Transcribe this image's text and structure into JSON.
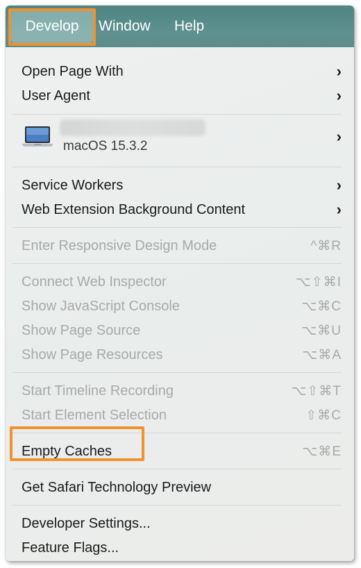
{
  "menubar": {
    "develop": "Develop",
    "window": "Window",
    "help": "Help"
  },
  "menu": {
    "open_page_with": "Open Page With",
    "user_agent": "User Agent",
    "device_os": "macOS 15.3.2",
    "service_workers": "Service Workers",
    "web_extension_bg": "Web Extension Background Content",
    "responsive_design": {
      "label": "Enter Responsive Design Mode",
      "shortcut": "^⌘R"
    },
    "connect_inspector": {
      "label": "Connect Web Inspector",
      "shortcut": "⌥⇧⌘I"
    },
    "js_console": {
      "label": "Show JavaScript Console",
      "shortcut": "⌥⌘C"
    },
    "page_source": {
      "label": "Show Page Source",
      "shortcut": "⌥⌘U"
    },
    "page_resources": {
      "label": "Show Page Resources",
      "shortcut": "⌥⌘A"
    },
    "timeline": {
      "label": "Start Timeline Recording",
      "shortcut": "⌥⇧⌘T"
    },
    "element_selection": {
      "label": "Start Element Selection",
      "shortcut": "⇧⌘C"
    },
    "empty_caches": {
      "label": "Empty Caches",
      "shortcut": "⌥⌘E"
    },
    "safari_tp": "Get Safari Technology Preview",
    "developer_settings": "Developer Settings...",
    "feature_flags": "Feature Flags..."
  },
  "icons": {
    "chevron": "›",
    "highlight_color": "#f0922e"
  }
}
